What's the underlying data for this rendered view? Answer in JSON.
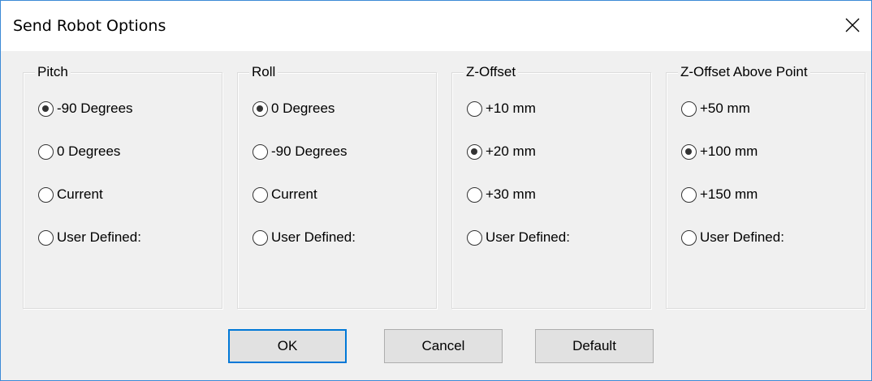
{
  "window": {
    "title": "Send Robot Options",
    "close_icon": "close-icon"
  },
  "groups": [
    {
      "label": "Pitch",
      "options": [
        {
          "label": "-90 Degrees",
          "selected": true
        },
        {
          "label": "0 Degrees",
          "selected": false
        },
        {
          "label": "Current",
          "selected": false
        },
        {
          "label": "User Defined:",
          "selected": false
        }
      ]
    },
    {
      "label": "Roll",
      "options": [
        {
          "label": "0 Degrees",
          "selected": true
        },
        {
          "label": "-90 Degrees",
          "selected": false
        },
        {
          "label": "Current",
          "selected": false
        },
        {
          "label": "User Defined:",
          "selected": false
        }
      ]
    },
    {
      "label": "Z-Offset",
      "options": [
        {
          "label": "+10 mm",
          "selected": false
        },
        {
          "label": "+20 mm",
          "selected": true
        },
        {
          "label": "+30 mm",
          "selected": false
        },
        {
          "label": "User Defined:",
          "selected": false
        }
      ]
    },
    {
      "label": "Z-Offset Above Point",
      "options": [
        {
          "label": "+50 mm",
          "selected": false
        },
        {
          "label": "+100 mm",
          "selected": true
        },
        {
          "label": "+150 mm",
          "selected": false
        },
        {
          "label": "User Defined:",
          "selected": false
        }
      ]
    }
  ],
  "buttons": {
    "ok": "OK",
    "cancel": "Cancel",
    "default": "Default"
  },
  "colors": {
    "window_border": "#3c8ad6",
    "focus_border": "#0078d7",
    "dialog_bg": "#f0f0f0"
  }
}
